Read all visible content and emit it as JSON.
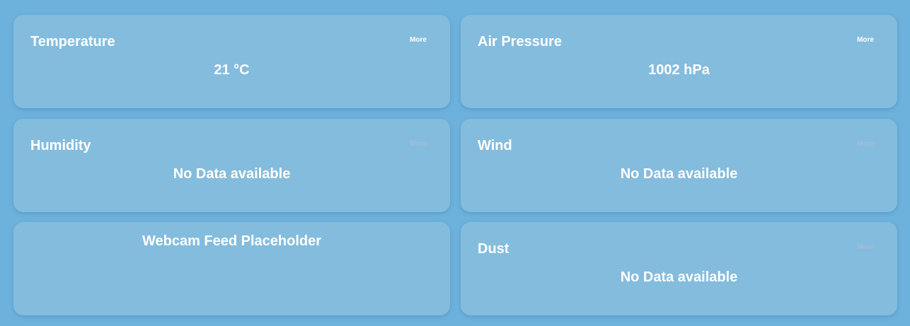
{
  "colors": {
    "background": "#6cb2dc",
    "card": "#84bcdd",
    "text": "#ffffff",
    "more_disabled": "#a3bfd1"
  },
  "cards": {
    "temperature": {
      "title": "Temperature",
      "more_label": "More",
      "value": "21 °C"
    },
    "air_pressure": {
      "title": "Air Pressure",
      "more_label": "More",
      "value": "1002 hPa"
    },
    "humidity": {
      "title": "Humidity",
      "more_label": "More",
      "value": "No Data available"
    },
    "wind": {
      "title": "Wind",
      "more_label": "More",
      "value": "No Data available"
    },
    "webcam": {
      "text": "Webcam Feed Placeholder"
    },
    "dust": {
      "title": "Dust",
      "more_label": "More",
      "value": "No Data available"
    }
  }
}
